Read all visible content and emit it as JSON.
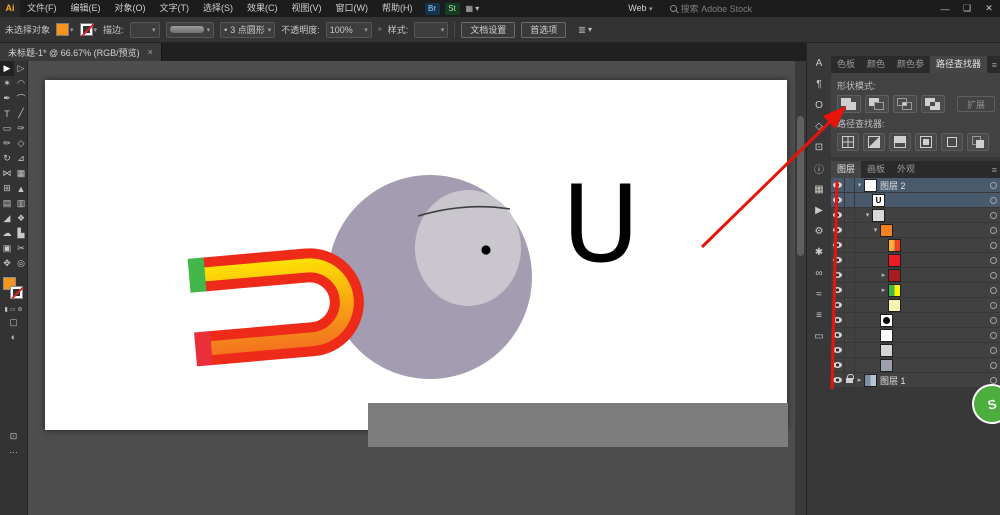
{
  "menubar": {
    "logo": "Ai",
    "items": [
      "文件(F)",
      "编辑(E)",
      "对象(O)",
      "文字(T)",
      "选择(S)",
      "效果(C)",
      "视图(V)",
      "窗口(W)",
      "帮助(H)"
    ],
    "bridge_badge": "Br",
    "stock_badge": "St",
    "workspace_label": "Web",
    "search_placeholder": "搜索 Adobe Stock",
    "window_controls": {
      "minimize": "—",
      "restore": "❑",
      "close": "✕"
    }
  },
  "controlbar": {
    "selection_status": "未选择对象",
    "stroke_label": "描边:",
    "brush_bullet": "•",
    "brush_value": "3 点圆形",
    "opacity_label": "不透明度:",
    "opacity_value": "100%",
    "style_label": "样式:",
    "doc_setup_button": "文档设置",
    "preferences_button": "首选项"
  },
  "document_tab": {
    "title": "未标题-1* @ 66.67% (RGB/预览)",
    "close": "×"
  },
  "toolbar": {
    "fill_color": "#F7941D",
    "tools": [
      {
        "name": "selection-tool",
        "glyph": "▶"
      },
      {
        "name": "direct-selection-tool",
        "glyph": "▷"
      },
      {
        "name": "magic-wand-tool",
        "glyph": "✶"
      },
      {
        "name": "lasso-tool",
        "glyph": "◠"
      },
      {
        "name": "pen-tool",
        "glyph": "✒"
      },
      {
        "name": "curvature-tool",
        "glyph": "⌒"
      },
      {
        "name": "type-tool",
        "glyph": "T"
      },
      {
        "name": "line-segment-tool",
        "glyph": "╱"
      },
      {
        "name": "rectangle-tool",
        "glyph": "▭"
      },
      {
        "name": "paintbrush-tool",
        "glyph": "✑"
      },
      {
        "name": "pencil-tool",
        "glyph": "✏"
      },
      {
        "name": "shaper-tool",
        "glyph": "◇"
      },
      {
        "name": "rotate-tool",
        "glyph": "↻"
      },
      {
        "name": "scale-tool",
        "glyph": "⊿"
      },
      {
        "name": "width-tool",
        "glyph": "⋈"
      },
      {
        "name": "free-transform-tool",
        "glyph": "▦"
      },
      {
        "name": "shape-builder-tool",
        "glyph": "⊞"
      },
      {
        "name": "perspective-grid-tool",
        "glyph": "▲"
      },
      {
        "name": "mesh-tool",
        "glyph": "▤"
      },
      {
        "name": "gradient-tool",
        "glyph": "▥"
      },
      {
        "name": "eyedropper-tool",
        "glyph": "◢"
      },
      {
        "name": "blend-tool",
        "glyph": "❖"
      },
      {
        "name": "symbol-sprayer-tool",
        "glyph": "☁"
      },
      {
        "name": "column-graph-tool",
        "glyph": "▙"
      },
      {
        "name": "artboard-tool",
        "glyph": "▣"
      },
      {
        "name": "slice-tool",
        "glyph": "✂"
      },
      {
        "name": "hand-tool",
        "glyph": "✥"
      },
      {
        "name": "zoom-tool",
        "glyph": "◎"
      }
    ]
  },
  "canvas": {
    "letter": "U",
    "head_color": "#a49db1",
    "face_color": "#c9c6ce",
    "magnet_red": "#ee2a18",
    "magnet_yellow": "#ffe900",
    "magnet_orange": "#f26522",
    "magnet_tip_top": "#41b649",
    "magnet_tip_bottom": "#ea2f3a"
  },
  "right_strip": {
    "icons": [
      {
        "name": "character-panel-icon",
        "glyph": "A"
      },
      {
        "name": "paragraph-panel-icon",
        "glyph": "¶"
      },
      {
        "name": "opentype-panel-icon",
        "glyph": "O"
      },
      {
        "name": "transform-panel-icon",
        "glyph": "◇"
      },
      {
        "name": "align-panel-icon",
        "glyph": "⊡"
      },
      {
        "name": "info-panel-icon",
        "glyph": "ⓘ"
      },
      {
        "name": "swatches-panel-icon",
        "glyph": "▦"
      },
      {
        "name": "actions-panel-icon",
        "glyph": "▶"
      },
      {
        "name": "settings-gear-icon",
        "glyph": "⚙"
      },
      {
        "name": "appearance-panel-icon",
        "glyph": "✱"
      },
      {
        "name": "cc-libraries-panel-icon",
        "glyph": "∞"
      },
      {
        "name": "stroke-panel-icon",
        "glyph": "≈"
      },
      {
        "name": "properties-panel-icon",
        "glyph": "≡"
      },
      {
        "name": "artboards-panel-icon",
        "glyph": "▭"
      }
    ]
  },
  "pathfinder_panel": {
    "tabs": [
      "色板",
      "颜色",
      "颜色参",
      "路径查找器"
    ],
    "active_tab": "路径查找器",
    "menu_icon": "≡",
    "shape_modes_label": "形状模式:",
    "expand_button": "扩展",
    "pathfinders_label": "路径查找器:"
  },
  "layers_panel": {
    "tabs": [
      "图层",
      "画板",
      "外观"
    ],
    "active_tab": "图层",
    "menu_icon": "≡",
    "thumb_palette": {
      "artwork": "#ffffff",
      "letter_u": "#ffffff",
      "group": "#d9d9d9",
      "magnet": "#f4831f",
      "orange_red": "#fbb040,#ef4123",
      "red": "#ed1c24",
      "dark_red": "#a51d20",
      "green_yellow": "#3eb549,#fff200",
      "pale_yellow": "#f7f3b5",
      "black_circle": "#ffffff",
      "white": "#ffffff",
      "light_gray": "#d4d4d4",
      "gray": "#9aa0ae",
      "layer1": "#7d8fa5,#b9c4d0"
    },
    "rows": [
      {
        "label": "图层 2",
        "chevron": "down",
        "thumb": "artwork",
        "indent": 0,
        "selected": true,
        "eye": true
      },
      {
        "label": "",
        "chevron": "",
        "thumb": "letter_u",
        "indent": 1,
        "selected": true,
        "eye": true
      },
      {
        "label": "",
        "chevron": "down",
        "thumb": "group",
        "indent": 1,
        "eye": true
      },
      {
        "label": "",
        "chevron": "down",
        "thumb": "magnet",
        "indent": 2,
        "eye": true
      },
      {
        "label": "",
        "chevron": "",
        "thumb": "orange_red",
        "indent": 3,
        "eye": true
      },
      {
        "label": "",
        "chevron": "",
        "thumb": "red",
        "indent": 3,
        "eye": true
      },
      {
        "label": "",
        "chevron": "right",
        "thumb": "dark_red",
        "indent": 3,
        "eye": true
      },
      {
        "label": "",
        "chevron": "right",
        "thumb": "green_yellow",
        "indent": 3,
        "eye": true
      },
      {
        "label": "",
        "chevron": "",
        "thumb": "pale_yellow",
        "indent": 3,
        "eye": true
      },
      {
        "label": "",
        "chevron": "",
        "thumb": "black_circle",
        "indent": 2,
        "eye": true
      },
      {
        "label": "",
        "chevron": "",
        "thumb": "white",
        "indent": 2,
        "eye": true
      },
      {
        "label": "",
        "chevron": "",
        "thumb": "light_gray",
        "indent": 2,
        "eye": true
      },
      {
        "label": "",
        "chevron": "",
        "thumb": "gray",
        "indent": 2,
        "eye": true
      },
      {
        "label": "图层 1",
        "chevron": "right",
        "thumb": "layer1",
        "indent": 0,
        "eye": true,
        "lock": true
      }
    ]
  },
  "annotation": {
    "color": "#e8140c"
  },
  "badge": {
    "text": "S"
  }
}
